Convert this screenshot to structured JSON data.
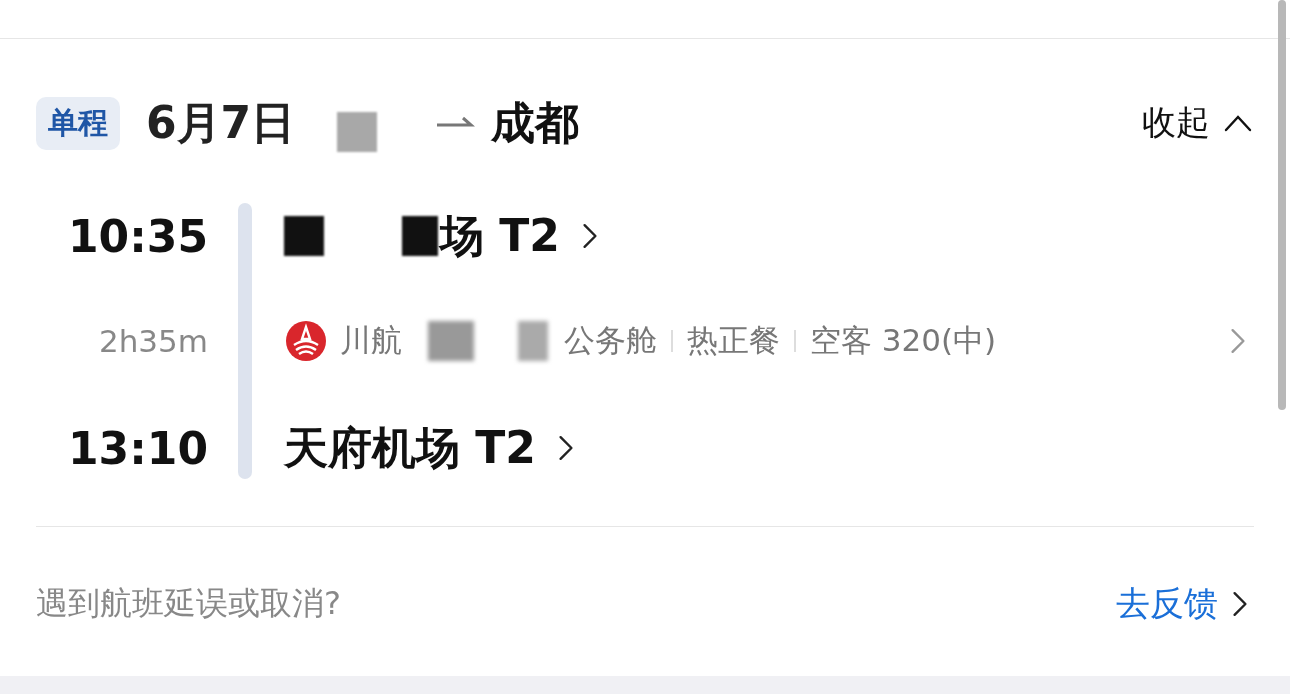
{
  "header": {
    "trip_type": "单程",
    "date": "6月7日",
    "destination": "成都",
    "collapse": "收起"
  },
  "flight": {
    "departure": {
      "time": "10:35",
      "airport": "场 T2"
    },
    "duration": "2h35m",
    "airline": "川航",
    "details": [
      "公务舱",
      "热正餐",
      "空客 320(中)"
    ],
    "arrival": {
      "time": "13:10",
      "airport": "天府机场 T2"
    }
  },
  "footer": {
    "question": "遇到航班延误或取消?",
    "link": "去反馈"
  }
}
